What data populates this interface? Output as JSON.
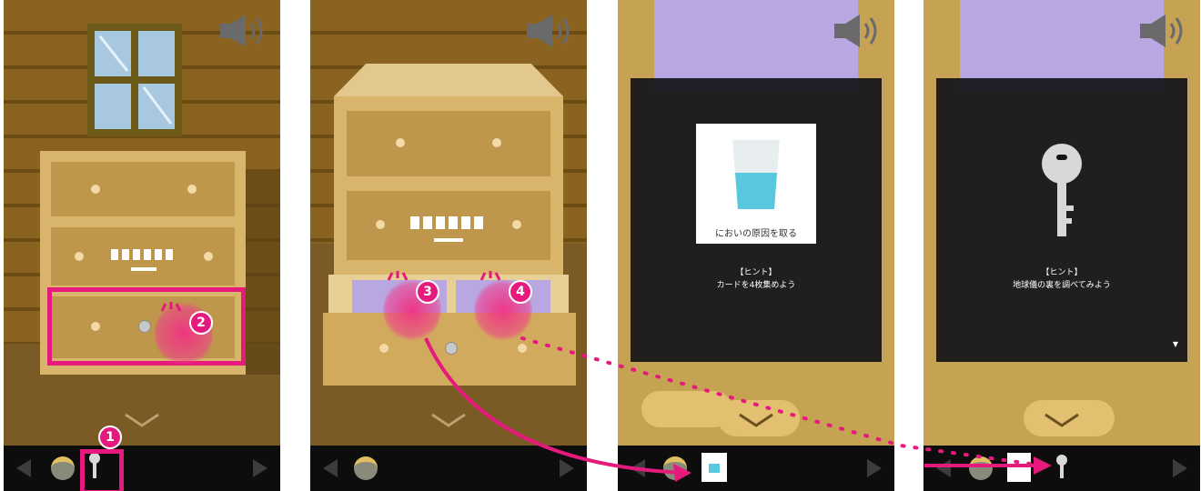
{
  "steps": {
    "step1": "1",
    "step2": "2",
    "step3": "3",
    "step4": "4"
  },
  "hints": {
    "card_caption": "においの原因を取る",
    "hint1_title": "【ヒント】",
    "hint1_text": "カードを4枚集めよう",
    "hint2_title": "【ヒント】",
    "hint2_text": "地球儀の裏を調べてみよう",
    "more_indicator": "▼"
  },
  "icons": {
    "sound": "speaker-icon",
    "back": "chevron-down-icon",
    "nav_left": "triangle-left-icon",
    "nav_right": "triangle-right-icon",
    "key": "key-icon",
    "helmet": "helmet-icon",
    "glass_card": "glass-card-icon"
  },
  "colors": {
    "highlight": "#e6197c",
    "wall": "#8a6320",
    "dresser": "#d9b56c",
    "inventory_bar": "#0d0d0d",
    "modal": "#14141a",
    "purple_light": "#b9a7e2"
  }
}
